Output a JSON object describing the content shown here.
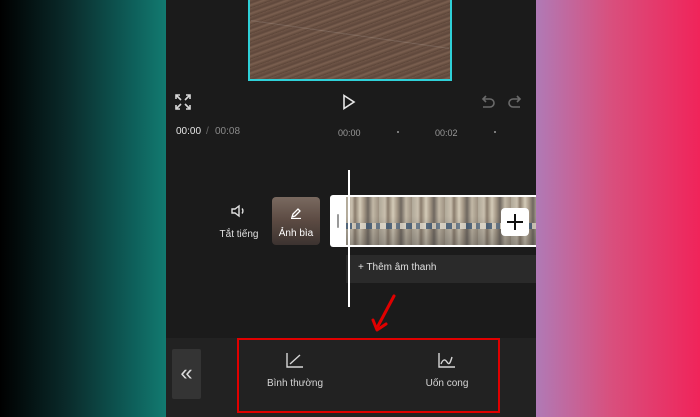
{
  "playback": {
    "current_time": "00:00",
    "separator": "/",
    "total_time": "00:08",
    "ticks": [
      "00:00",
      "00:02"
    ]
  },
  "track": {
    "mute_label": "Tắt tiếng",
    "cover_label": "Ảnh bìa",
    "add_audio_label": "+ Thêm âm thanh"
  },
  "toolbar": {
    "back_glyph": "«",
    "tools": [
      {
        "label": "Bình thường",
        "icon": "line-graph-icon"
      },
      {
        "label": "Uốn cong",
        "icon": "curve-graph-icon"
      }
    ]
  },
  "colors": {
    "accent": "#2fd0d8",
    "highlight": "#e00000",
    "background": "#1b1b1b"
  }
}
